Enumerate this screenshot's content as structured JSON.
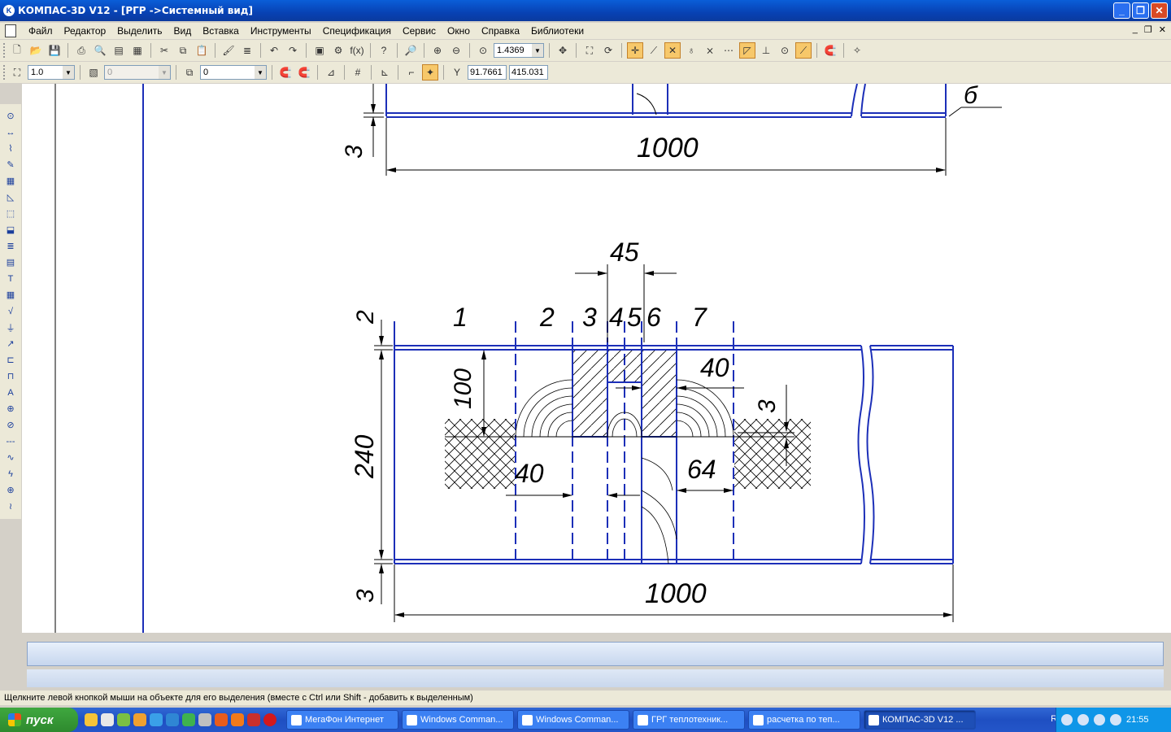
{
  "window": {
    "title": "КОМПАС-3D V12 - [РГР ->Системный вид]",
    "buttons": [
      "_",
      "❐",
      "✕"
    ]
  },
  "menu": [
    "Файл",
    "Редактор",
    "Выделить",
    "Вид",
    "Вставка",
    "Инструменты",
    "Спецификация",
    "Сервис",
    "Окно",
    "Справка",
    "Библиотеки"
  ],
  "toolbar1": {
    "zoom_value": "1.4369"
  },
  "toolbar2": {
    "scale_value": "1.0",
    "layer_value": "0",
    "style_value": "0",
    "coord_x": "91.7661",
    "coord_y": "415.031"
  },
  "drawing": {
    "upper_dim_height": "3",
    "upper_length": "1000",
    "upper_label": "б",
    "width_45": "45",
    "zone_labels": [
      "1",
      "2",
      "3",
      "4",
      "5",
      "6",
      "7"
    ],
    "dim_2": "2",
    "dim_100": "100",
    "dim_240": "240",
    "dim_40_right": "40",
    "dim_3_right": "3",
    "dim_40_left": "40",
    "dim_64": "64",
    "lower_dim_height": "3",
    "lower_length": "1000"
  },
  "status_text": "Щелкните левой кнопкой мыши на объекте для его выделения (вместе с Ctrl или Shift - добавить к выделенным)",
  "taskbar": {
    "start": "пуск",
    "tasks": [
      "МегаФон Интернет",
      "Windows Comman...",
      "Windows Comman...",
      "ГРГ теплотехник...",
      "расчетка по теп...",
      "КОМПАС-3D V12 ..."
    ],
    "lang": "RU",
    "clock": "21:55"
  }
}
